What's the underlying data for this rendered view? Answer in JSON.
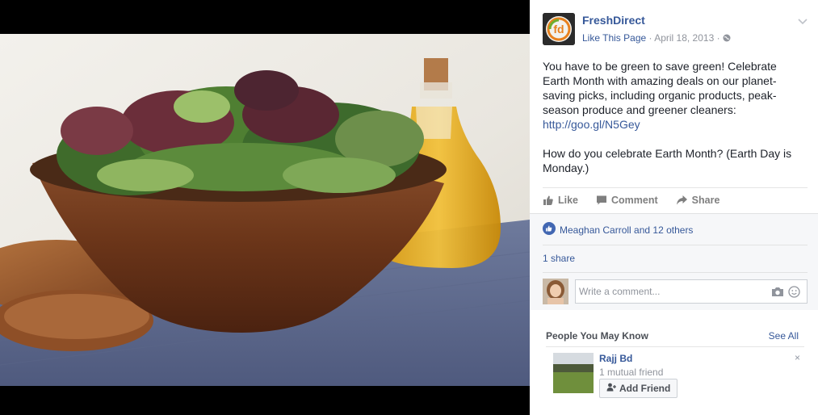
{
  "post": {
    "page_name": "FreshDirect",
    "like_page_label": "Like This Page",
    "separator": "·",
    "date": "April 18, 2013",
    "paragraph1_text": "You have to be green to save green! Celebrate Earth Month with amazing deals on our planet-saving picks, including organic products, peak-season produce and greener cleaners: ",
    "paragraph1_link": "http://goo.gl/N5Gey",
    "paragraph2": "How do you celebrate Earth Month? (Earth Day is Monday.)"
  },
  "actions": {
    "like": "Like",
    "comment": "Comment",
    "share": "Share"
  },
  "feedback": {
    "reactions": "Meaghan Carroll and 12 others",
    "shares": "1 share",
    "comment_placeholder": "Write a comment..."
  },
  "pymk": {
    "title": "People You May Know",
    "see_all": "See All",
    "friend_name": "Rajj Bd",
    "mutual": "1 mutual friend",
    "add_friend": "Add Friend",
    "close": "×"
  },
  "icons": {
    "chevron": "chevron-down-icon",
    "globe": "globe-icon",
    "like": "thumbs-up-icon",
    "comment": "comment-icon",
    "share": "share-icon",
    "reaction": "like-reaction-icon",
    "camera": "camera-icon",
    "smile": "smiley-icon",
    "add_friend": "add-friend-icon"
  },
  "colors": {
    "link": "#365899",
    "muted": "#90949c",
    "text": "#1d2129",
    "like_blue": "#4267b2"
  }
}
